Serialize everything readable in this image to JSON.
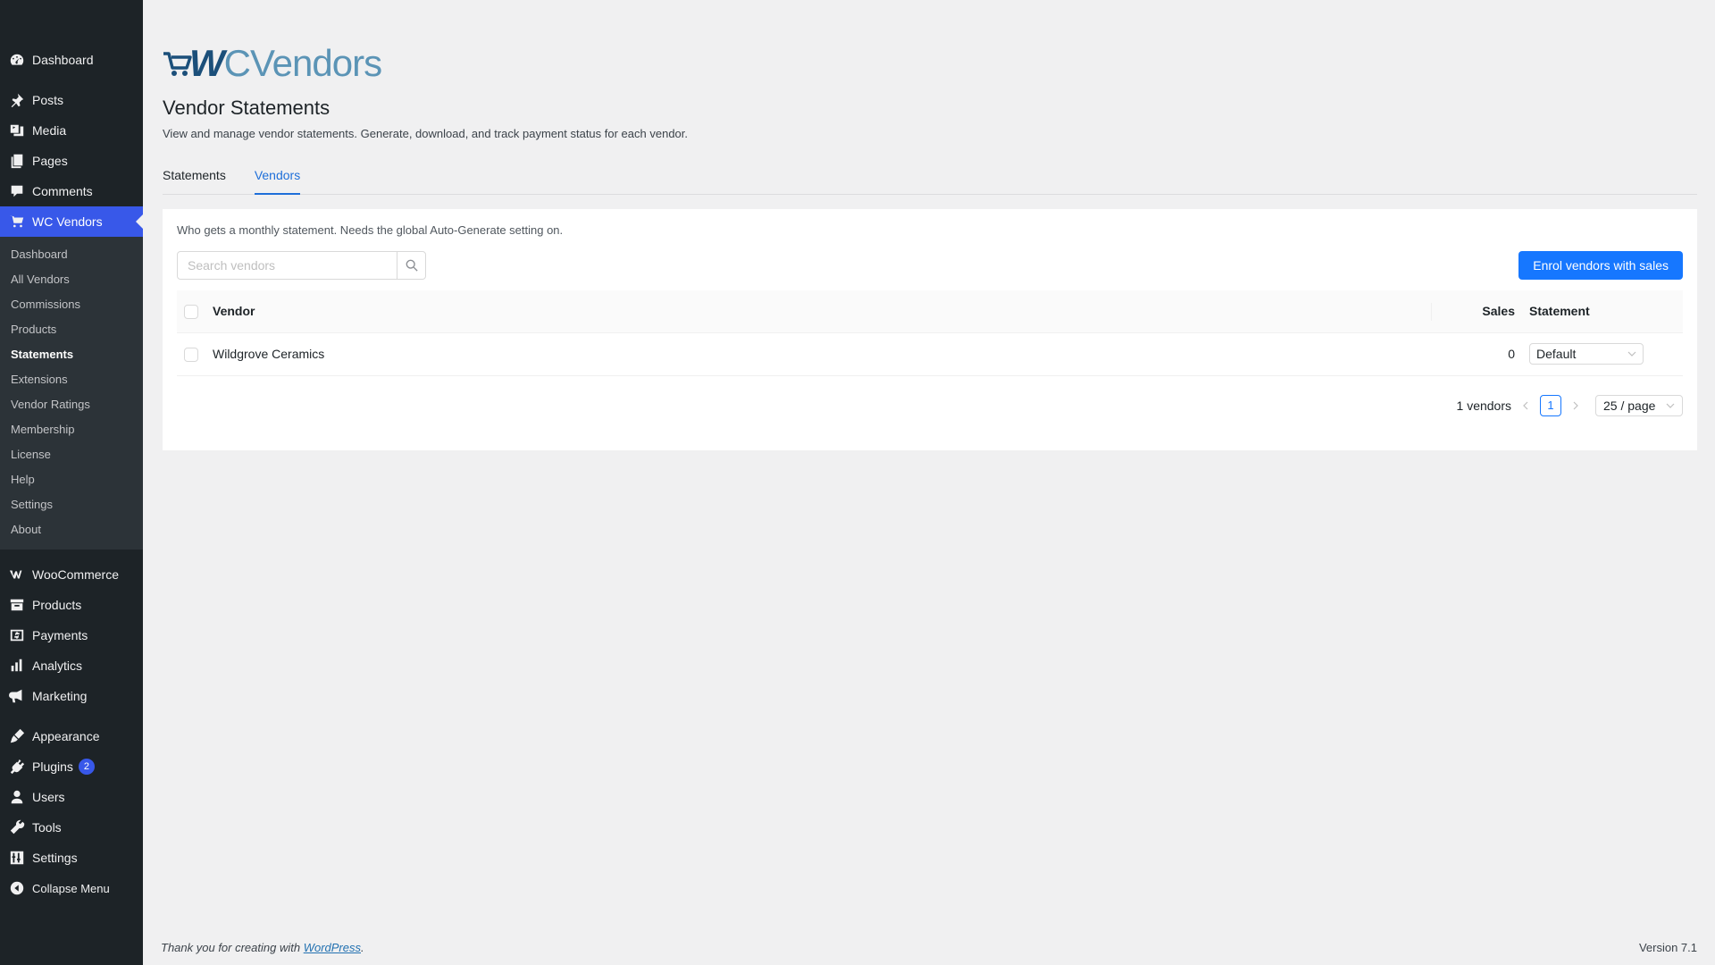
{
  "sidebar": {
    "top": [
      {
        "label": "Dashboard",
        "icon": "dashboard-icon"
      }
    ],
    "group1": [
      {
        "label": "Posts",
        "icon": "pin-icon"
      },
      {
        "label": "Media",
        "icon": "media-icon"
      },
      {
        "label": "Pages",
        "icon": "pages-icon"
      },
      {
        "label": "Comments",
        "icon": "comment-icon"
      },
      {
        "label": "WC Vendors",
        "icon": "cart-icon"
      }
    ],
    "wcv_submenu": [
      "Dashboard",
      "All Vendors",
      "Commissions",
      "Products",
      "Statements",
      "Extensions",
      "Vendor Ratings",
      "Membership",
      "License",
      "Help",
      "Settings",
      "About"
    ],
    "group2": [
      {
        "label": "WooCommerce",
        "icon": "woo-icon"
      },
      {
        "label": "Products",
        "icon": "archive-icon"
      },
      {
        "label": "Payments",
        "icon": "dollar-icon"
      },
      {
        "label": "Analytics",
        "icon": "bar-chart-icon"
      },
      {
        "label": "Marketing",
        "icon": "megaphone-icon"
      }
    ],
    "group3": [
      {
        "label": "Appearance",
        "icon": "brush-icon"
      },
      {
        "label": "Plugins",
        "icon": "plugin-icon",
        "badge": "2"
      },
      {
        "label": "Users",
        "icon": "user-icon"
      },
      {
        "label": "Tools",
        "icon": "wrench-icon"
      },
      {
        "label": "Settings",
        "icon": "settings-icon"
      },
      {
        "label": "Collapse Menu",
        "icon": "collapse-icon"
      }
    ]
  },
  "logo": {
    "w": "W",
    "rest": "CVendors"
  },
  "page": {
    "title": "Vendor Statements",
    "description": "View and manage vendor statements. Generate, download, and track payment status for each vendor."
  },
  "tabs": [
    "Statements",
    "Vendors"
  ],
  "active_tab": "Vendors",
  "panel": {
    "note": "Who gets a monthly statement. Needs the global Auto-Generate setting on.",
    "search_placeholder": "Search vendors",
    "enrol_button": "Enrol vendors with sales"
  },
  "table": {
    "headers": {
      "vendor": "Vendor",
      "sales": "Sales",
      "statement": "Statement"
    },
    "rows": [
      {
        "vendor": "Wildgrove Ceramics",
        "sales": "0",
        "statement": "Default"
      }
    ]
  },
  "pagination": {
    "total": "1 vendors",
    "current_page": "1",
    "page_size": "25 / page"
  },
  "footer": {
    "thanks_prefix": "Thank you for creating with ",
    "link": "WordPress",
    "suffix": ".",
    "version": "Version 7.1"
  },
  "colors": {
    "sidebar_bg": "#1d2327",
    "accent": "#1677ff",
    "menu_current": "#3858e9"
  }
}
